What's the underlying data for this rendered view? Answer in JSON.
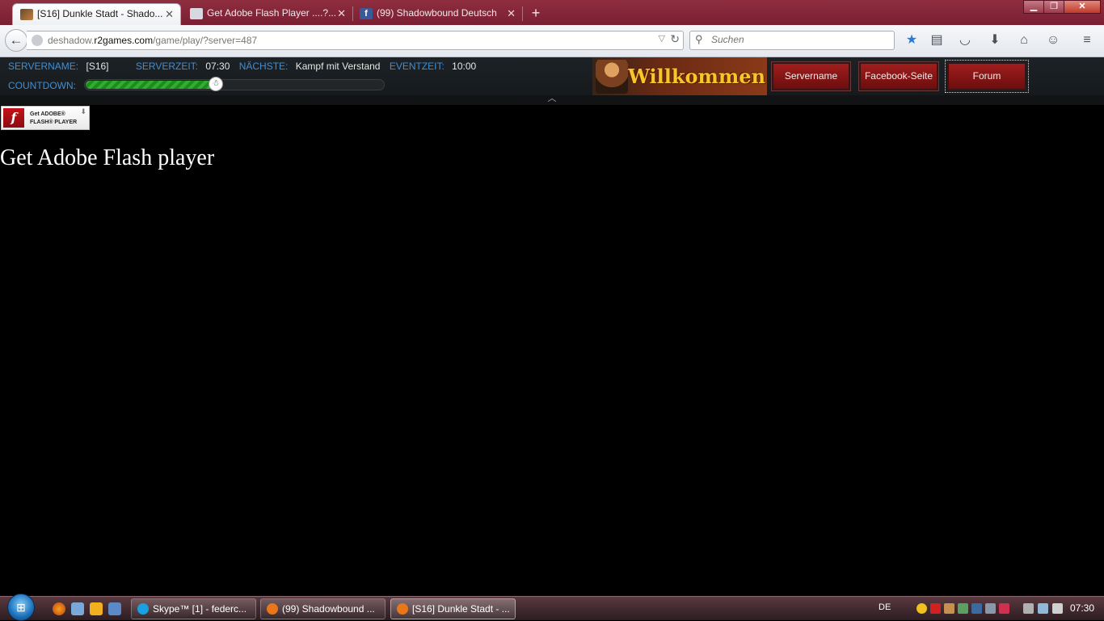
{
  "browser": {
    "tabs": [
      {
        "title": "[S16] Dunkle Stadt - Shado...",
        "active": true
      },
      {
        "title": "Get Adobe Flash Player ....?...",
        "active": false
      },
      {
        "title": "(99) Shadowbound Deutsch",
        "active": false
      }
    ],
    "new_tab": "+",
    "url_prefix": "deshadow.",
    "url_domain": "r2games.com",
    "url_path": "/game/play/?server=487",
    "search_placeholder": "Suchen"
  },
  "game": {
    "servername_label": "SERVERNAME:",
    "servername_value": "[S16]",
    "serverzeit_label": "SERVERZEIT:",
    "serverzeit_value": "07:30",
    "naechste_label": "NÄCHSTE:",
    "naechste_value": "Kampf mit Verstand",
    "eventzeit_label": "EVENTZEIT:",
    "eventzeit_value": "10:00",
    "countdown_label": "COUNTDOWN:",
    "countdown_progress": 0.44,
    "banner": "Willkommen",
    "buttons": [
      "Servername",
      "Facebook-Seite",
      "Forum"
    ]
  },
  "content": {
    "badge_line1": "Get ADOBE®",
    "badge_line2": "FLASH® PLAYER",
    "title": "Get Adobe Flash player"
  },
  "taskbar": {
    "items": [
      {
        "label": "Skype™ [1] - federc...",
        "color": "#1aa0e0"
      },
      {
        "label": "(99) Shadowbound ...",
        "color": "#e8761a"
      },
      {
        "label": "[S16] Dunkle Stadt - ...",
        "color": "#e8761a"
      }
    ],
    "lang": "DE",
    "clock": "07:30"
  }
}
